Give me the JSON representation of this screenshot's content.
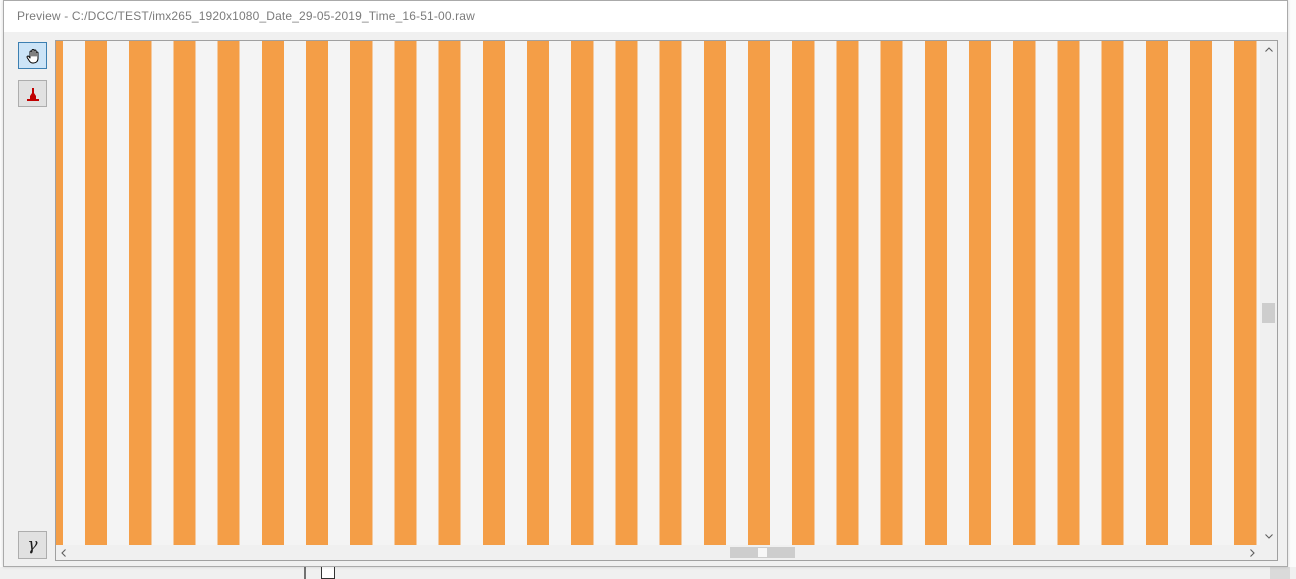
{
  "window": {
    "title": "Preview - C:/DCC/TEST/imx265_1920x1080_Date_29-05-2019_Time_16-51-00.raw"
  },
  "toolbar": {
    "tools": {
      "pan": {
        "icon": "hand-icon",
        "selected": true
      },
      "histogram": {
        "icon": "histogram-icon",
        "selected": false
      }
    },
    "gamma_label": "γ"
  },
  "preview": {
    "stripe_color": "#f49e47",
    "gap_color": "#f4f4f4"
  },
  "scrollbars": {
    "icons": {
      "up": "chevron-up-icon",
      "down": "chevron-down-icon",
      "left": "chevron-left-icon",
      "right": "chevron-right-icon"
    }
  },
  "colors": {
    "selected_tool_background": "#cce4f7",
    "selected_tool_border": "#3c7fb1",
    "histogram_icon": "#c00000",
    "title_text": "#7b7b7b",
    "window_body": "#f0f0f0"
  }
}
